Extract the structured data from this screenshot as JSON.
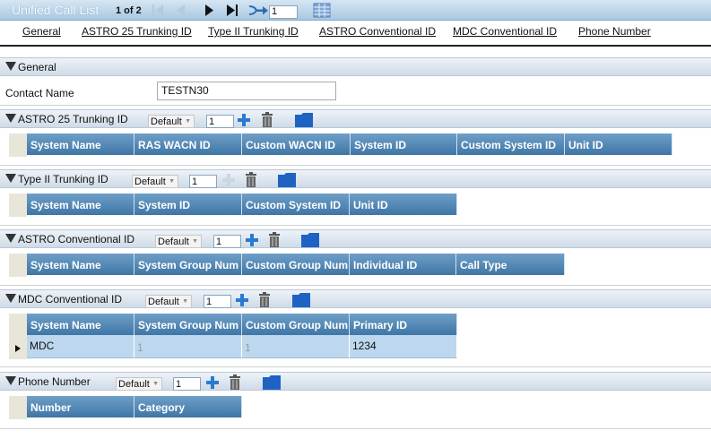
{
  "titlebar": {
    "title": "Unified Call List",
    "pager": "1 of 2",
    "page_value": "1",
    "icons": [
      "first-page-icon",
      "previous-page-icon",
      "next-page-icon",
      "last-page-icon",
      "goto-page-icon",
      "grid-view-icon"
    ]
  },
  "nav": {
    "links": [
      "General",
      "ASTRO 25 Trunking ID",
      "Type II Trunking ID",
      "ASTRO Conventional ID",
      "MDC Conventional ID",
      "Phone Number"
    ]
  },
  "general": {
    "label": "General",
    "contact_label": "Contact Name",
    "contact_value": "TESTN30"
  },
  "astro25": {
    "label": "ASTRO 25 Trunking ID",
    "dropdown": "Default",
    "count": "1",
    "columns": [
      "System Name",
      "RAS WACN ID",
      "Custom WACN ID",
      "System ID",
      "Custom System ID",
      "Unit ID"
    ]
  },
  "type2": {
    "label": "Type II Trunking ID",
    "dropdown": "Default",
    "count": "1",
    "columns": [
      "System Name",
      "System ID",
      "Custom System ID",
      "Unit ID"
    ]
  },
  "astroconv": {
    "label": "ASTRO Conventional ID",
    "dropdown": "Default",
    "count": "1",
    "columns": [
      "System Name",
      "System Group Num",
      "Custom Group Num",
      "Individual ID",
      "Call Type"
    ]
  },
  "mdc": {
    "label": "MDC Conventional ID",
    "dropdown": "Default",
    "count": "1",
    "columns": [
      "System Name",
      "System Group Num",
      "Custom Group Num",
      "Primary ID"
    ],
    "rows": [
      [
        "MDC",
        "1",
        "1",
        "1234"
      ]
    ]
  },
  "phone": {
    "label": "Phone Number",
    "dropdown": "Default",
    "count": "1",
    "columns": [
      "Number",
      "Category"
    ]
  },
  "colors": {
    "header_blue": "#3f76a6",
    "row_blue": "#bdd8ee",
    "add_icon_blue": "#2a7ad1",
    "folder_blue": "#1e63c4"
  }
}
